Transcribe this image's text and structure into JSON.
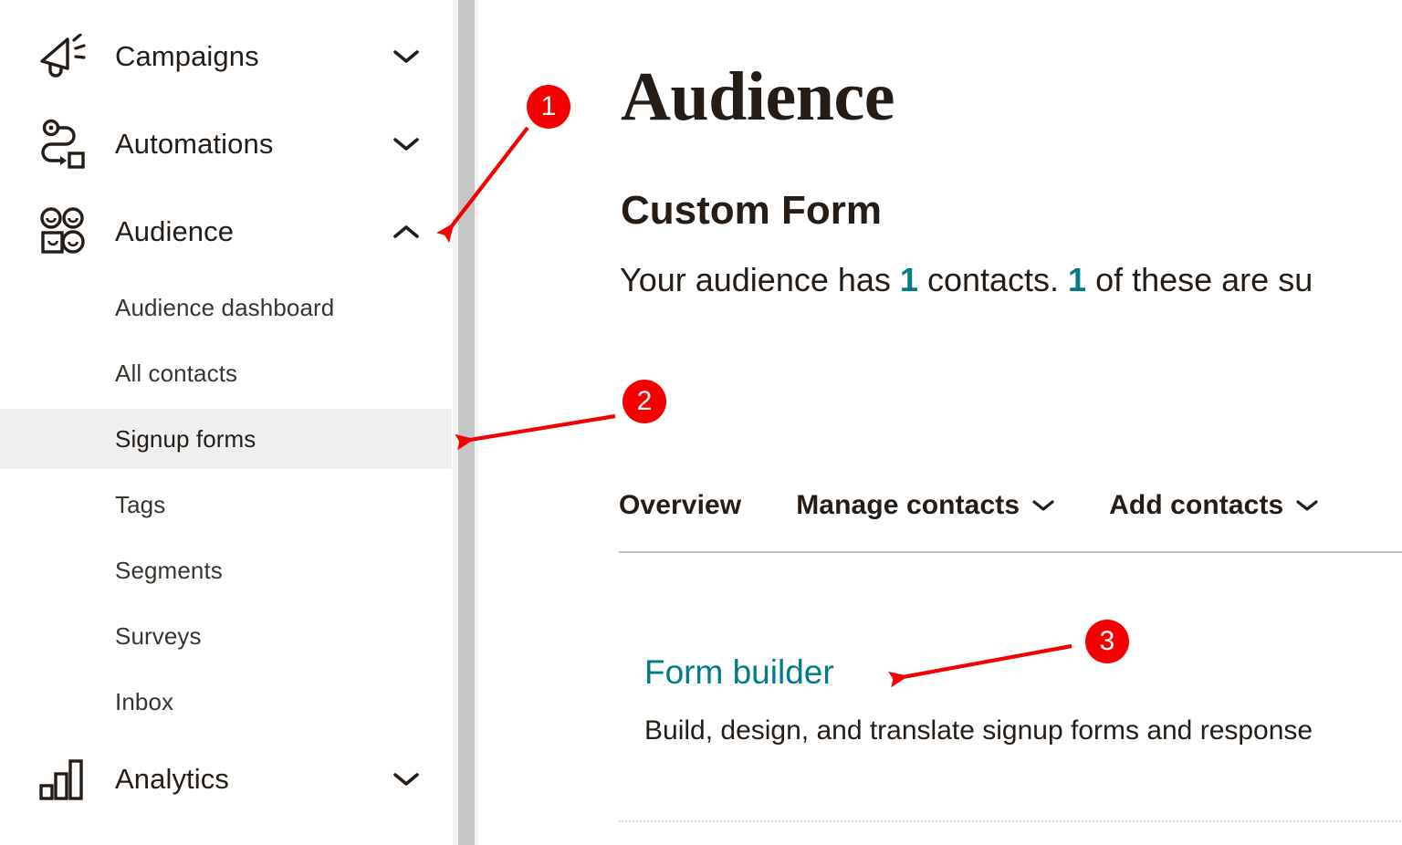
{
  "sidebar": {
    "groups": [
      {
        "label": "Campaigns",
        "icon": "megaphone-icon",
        "chevron": "chevron-down-icon",
        "expanded": false
      },
      {
        "label": "Automations",
        "icon": "automation-path-icon",
        "chevron": "chevron-down-icon",
        "expanded": false
      },
      {
        "label": "Audience",
        "icon": "audience-people-icon",
        "chevron": "chevron-up-icon",
        "expanded": true
      },
      {
        "label": "Analytics",
        "icon": "bar-chart-icon",
        "chevron": "chevron-down-icon",
        "expanded": false
      }
    ],
    "audience_subitems": [
      {
        "label": "Audience dashboard",
        "active": false
      },
      {
        "label": "All contacts",
        "active": false
      },
      {
        "label": "Signup forms",
        "active": true
      },
      {
        "label": "Tags",
        "active": false
      },
      {
        "label": "Segments",
        "active": false
      },
      {
        "label": "Surveys",
        "active": false
      },
      {
        "label": "Inbox",
        "active": false
      }
    ],
    "scrollbar": {
      "name": "vertical-scrollbar"
    }
  },
  "main": {
    "title": "Audience",
    "subtitle": "Custom Form",
    "summary": {
      "part1": "Your audience has ",
      "count1": "1",
      "part2": " contacts. ",
      "count2": "1",
      "part3": " of these are su"
    },
    "tabs": [
      {
        "label": "Overview",
        "chevron": false
      },
      {
        "label": "Manage contacts",
        "chevron": true
      },
      {
        "label": "Add contacts",
        "chevron": true
      }
    ],
    "form_builder": {
      "link": "Form builder",
      "description": "Build, design, and translate signup forms and response"
    }
  },
  "annotations": {
    "badges": [
      {
        "number": "1",
        "target": "audience-chevron"
      },
      {
        "number": "2",
        "target": "signup-forms-row"
      },
      {
        "number": "3",
        "target": "form-builder-link"
      }
    ],
    "accent_color": "#f40000"
  },
  "colors": {
    "teal": "#007c89",
    "text": "#241c15",
    "sub_text": "#3a342e",
    "highlight_bg": "#efefef",
    "rule": "#bdbdbd",
    "scroll_thumb": "#c6c6c6",
    "scroll_track": "#f4f4f4"
  }
}
